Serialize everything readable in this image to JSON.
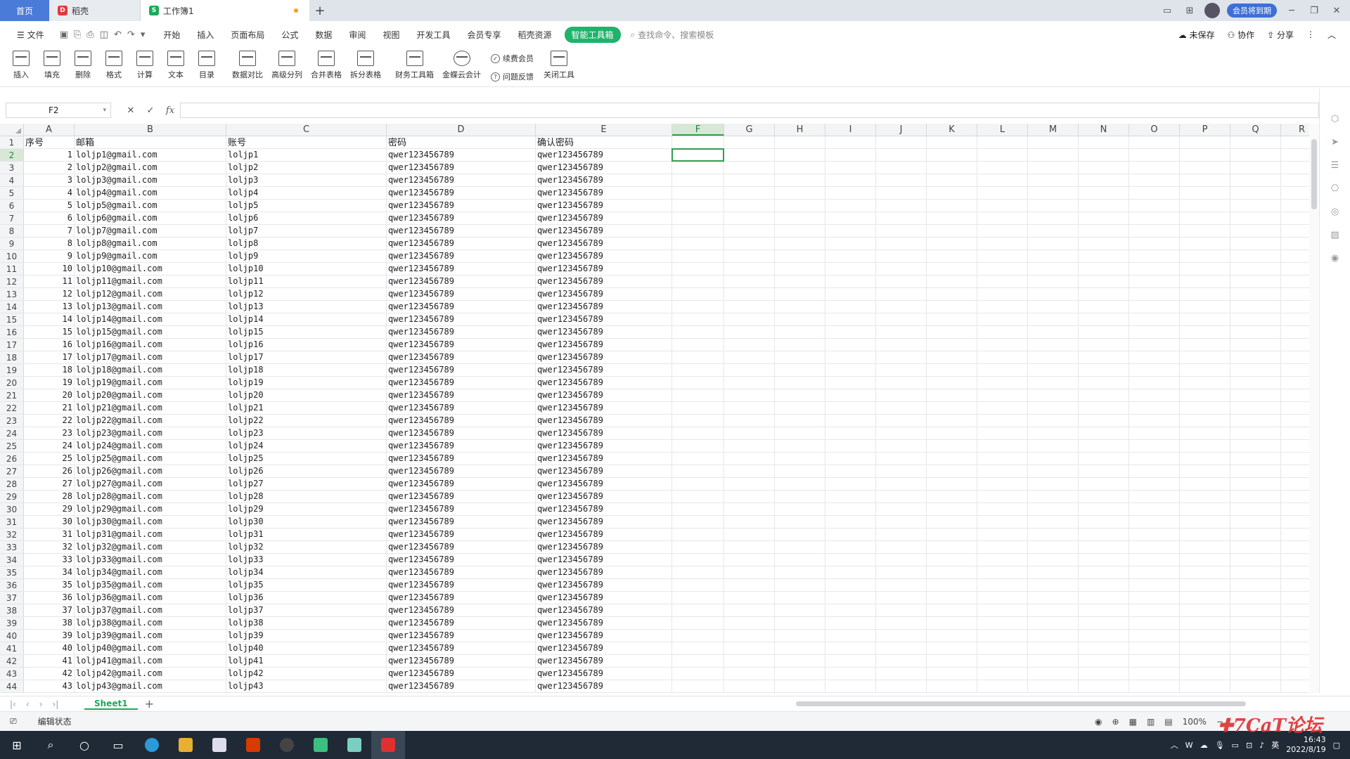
{
  "tabs": {
    "home": "首页",
    "docer": "稻壳",
    "workbook": "工作簿1",
    "member": "会员将到期"
  },
  "menu": {
    "file": "文件",
    "items": [
      "开始",
      "插入",
      "页面布局",
      "公式",
      "数据",
      "审阅",
      "视图",
      "开发工具",
      "会员专享",
      "稻壳资源"
    ],
    "highlight": "智能工具箱",
    "search": "查找命令、搜索模板",
    "unsaved": "未保存",
    "collab": "协作",
    "share": "分享"
  },
  "ribbon": {
    "buttons": [
      "插入",
      "填充",
      "删除",
      "格式",
      "计算",
      "文本",
      "目录",
      "数据对比",
      "高级分列",
      "合并表格",
      "拆分表格",
      "财务工具箱",
      "金蝶云会计"
    ],
    "renew": "续费会员",
    "feedback": "问题反馈",
    "close": "关闭工具"
  },
  "formula_bar": {
    "cell_ref": "F2",
    "fx": "fx",
    "value": ""
  },
  "grid": {
    "columns": [
      "A",
      "B",
      "C",
      "D",
      "E",
      "F",
      "G",
      "H",
      "I",
      "J",
      "K",
      "L",
      "M",
      "N",
      "O",
      "P",
      "Q",
      "R"
    ],
    "selected_column": "F",
    "selected_row": 2,
    "headers": [
      "序号",
      "邮箱",
      "账号",
      "密码",
      "确认密码"
    ],
    "password": "qwer123456789",
    "rows": [
      {
        "n": "1",
        "email": "loljp1@gmail.com",
        "account": "loljp1"
      },
      {
        "n": "2",
        "email": "loljp2@gmail.com",
        "account": "loljp2"
      },
      {
        "n": "3",
        "email": "loljp3@gmail.com",
        "account": "loljp3"
      },
      {
        "n": "4",
        "email": "loljp4@gmail.com",
        "account": "loljp4"
      },
      {
        "n": "5",
        "email": "loljp5@gmail.com",
        "account": "loljp5"
      },
      {
        "n": "6",
        "email": "loljp6@gmail.com",
        "account": "loljp6"
      },
      {
        "n": "7",
        "email": "loljp7@gmail.com",
        "account": "loljp7"
      },
      {
        "n": "8",
        "email": "loljp8@gmail.com",
        "account": "loljp8"
      },
      {
        "n": "9",
        "email": "loljp9@gmail.com",
        "account": "loljp9"
      },
      {
        "n": "10",
        "email": "loljp10@gmail.com",
        "account": "loljp10"
      },
      {
        "n": "11",
        "email": "loljp11@gmail.com",
        "account": "loljp11"
      },
      {
        "n": "12",
        "email": "loljp12@gmail.com",
        "account": "loljp12"
      },
      {
        "n": "13",
        "email": "loljp13@gmail.com",
        "account": "loljp13"
      },
      {
        "n": "14",
        "email": "loljp14@gmail.com",
        "account": "loljp14"
      },
      {
        "n": "15",
        "email": "loljp15@gmail.com",
        "account": "loljp15"
      },
      {
        "n": "16",
        "email": "loljp16@gmail.com",
        "account": "loljp16"
      },
      {
        "n": "17",
        "email": "loljp17@gmail.com",
        "account": "loljp17"
      },
      {
        "n": "18",
        "email": "loljp18@gmail.com",
        "account": "loljp18"
      },
      {
        "n": "19",
        "email": "loljp19@gmail.com",
        "account": "loljp19"
      },
      {
        "n": "20",
        "email": "loljp20@gmail.com",
        "account": "loljp20"
      },
      {
        "n": "21",
        "email": "loljp21@gmail.com",
        "account": "loljp21"
      },
      {
        "n": "22",
        "email": "loljp22@gmail.com",
        "account": "loljp22"
      },
      {
        "n": "23",
        "email": "loljp23@gmail.com",
        "account": "loljp23"
      },
      {
        "n": "24",
        "email": "loljp24@gmail.com",
        "account": "loljp24"
      },
      {
        "n": "25",
        "email": "loljp25@gmail.com",
        "account": "loljp25"
      },
      {
        "n": "26",
        "email": "loljp26@gmail.com",
        "account": "loljp26"
      },
      {
        "n": "27",
        "email": "loljp27@gmail.com",
        "account": "loljp27"
      },
      {
        "n": "28",
        "email": "loljp28@gmail.com",
        "account": "loljp28"
      },
      {
        "n": "29",
        "email": "loljp29@gmail.com",
        "account": "loljp29"
      },
      {
        "n": "30",
        "email": "loljp30@gmail.com",
        "account": "loljp30"
      },
      {
        "n": "31",
        "email": "loljp31@gmail.com",
        "account": "loljp31"
      },
      {
        "n": "32",
        "email": "loljp32@gmail.com",
        "account": "loljp32"
      },
      {
        "n": "33",
        "email": "loljp33@gmail.com",
        "account": "loljp33"
      },
      {
        "n": "34",
        "email": "loljp34@gmail.com",
        "account": "loljp34"
      },
      {
        "n": "35",
        "email": "loljp35@gmail.com",
        "account": "loljp35"
      },
      {
        "n": "36",
        "email": "loljp36@gmail.com",
        "account": "loljp36"
      },
      {
        "n": "37",
        "email": "loljp37@gmail.com",
        "account": "loljp37"
      },
      {
        "n": "38",
        "email": "loljp38@gmail.com",
        "account": "loljp38"
      },
      {
        "n": "39",
        "email": "loljp39@gmail.com",
        "account": "loljp39"
      },
      {
        "n": "40",
        "email": "loljp40@gmail.com",
        "account": "loljp40"
      },
      {
        "n": "41",
        "email": "loljp41@gmail.com",
        "account": "loljp41"
      },
      {
        "n": "42",
        "email": "loljp42@gmail.com",
        "account": "loljp42"
      },
      {
        "n": "43",
        "email": "loljp43@gmail.com",
        "account": "loljp43"
      }
    ]
  },
  "sheet": {
    "name": "Sheet1"
  },
  "status": {
    "mode": "编辑状态",
    "zoom": "100%"
  },
  "taskbar": {
    "ime": "英",
    "time": "16:43",
    "date": "2022/8/19"
  },
  "colors": {
    "accent_green": "#1fa85a",
    "tab_blue": "#4a7bd8"
  }
}
